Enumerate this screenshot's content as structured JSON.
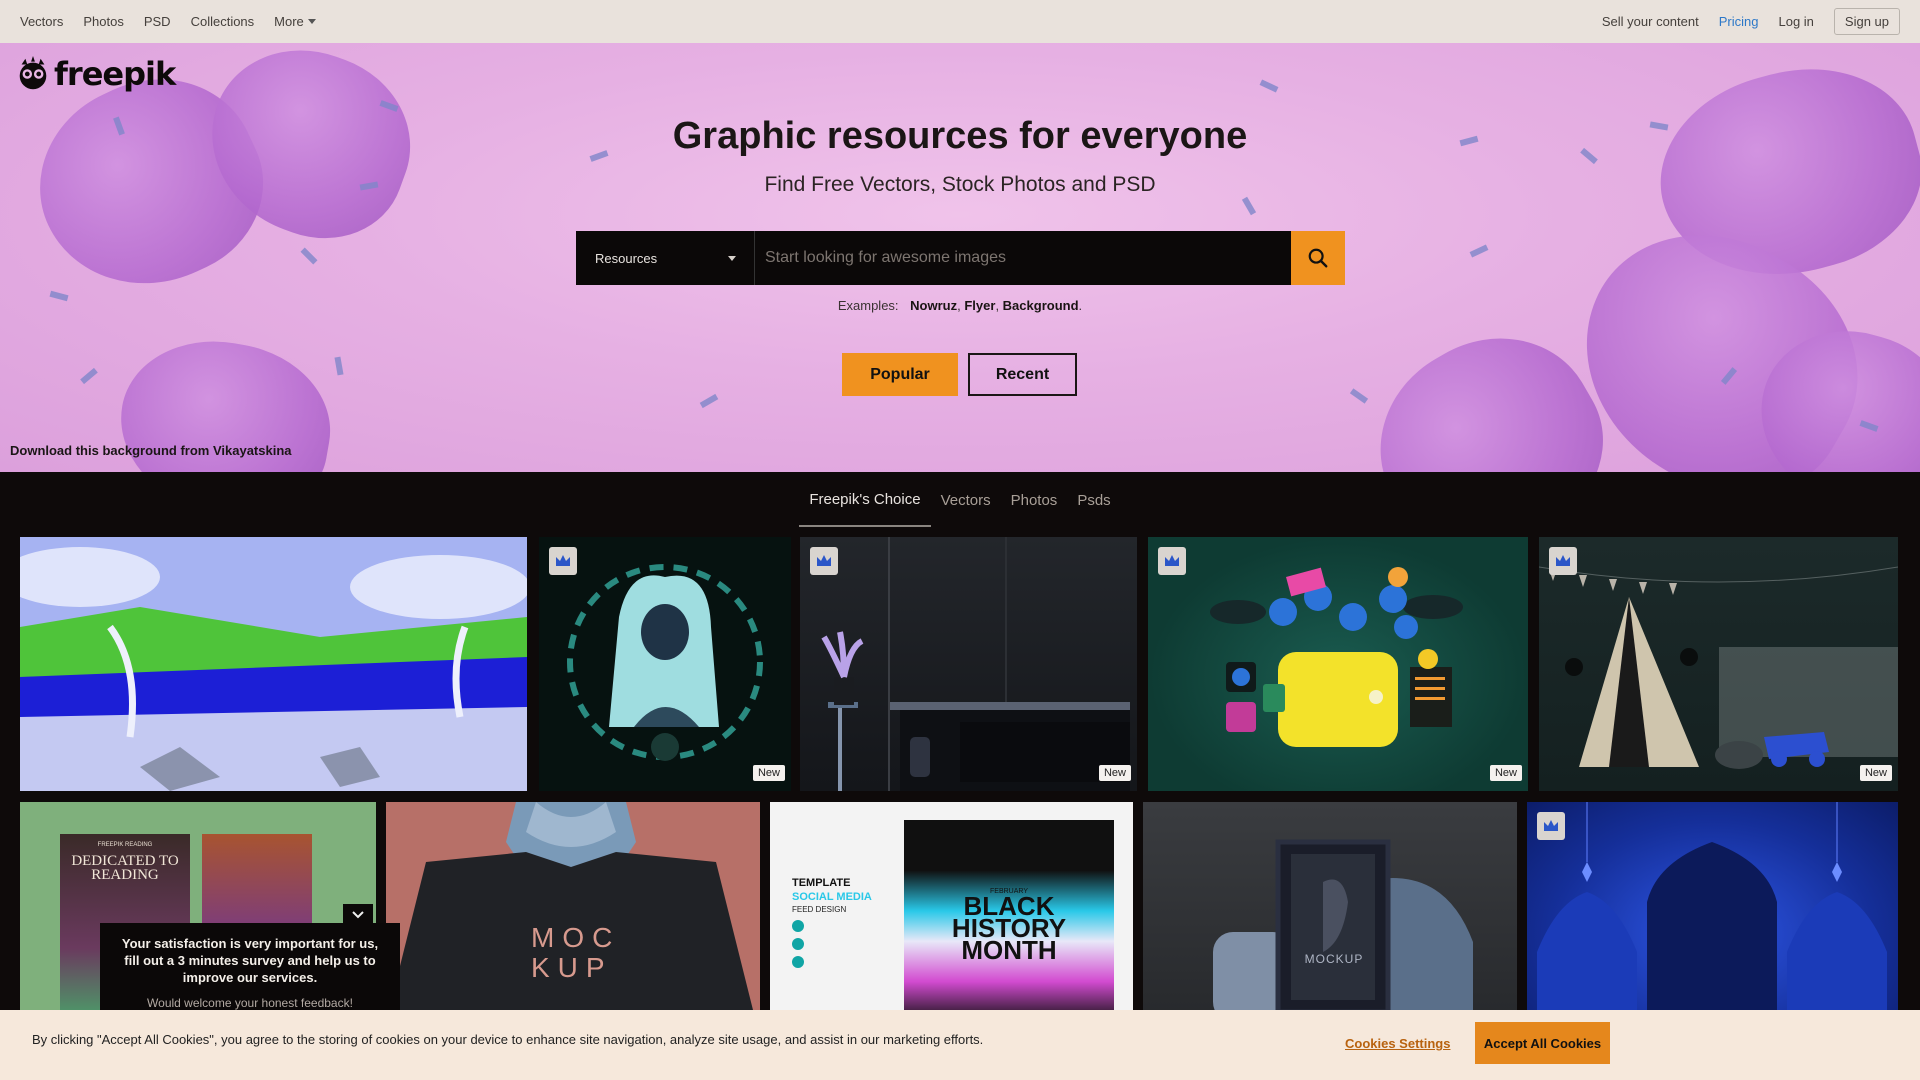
{
  "topnav": {
    "left_links": [
      "Vectors",
      "Photos",
      "PSD",
      "Collections"
    ],
    "more_label": "More",
    "sell_label": "Sell your content",
    "pricing_label": "Pricing",
    "login_label": "Log in",
    "signup_label": "Sign up"
  },
  "brand": {
    "logo_text": "freepik"
  },
  "hero": {
    "title": "Graphic resources for everyone",
    "subtitle": "Find Free Vectors, Stock Photos and PSD",
    "search_type": "Resources",
    "search_placeholder": "Start looking for awesome images",
    "examples_label": "Examples:",
    "examples": [
      "Nowruz",
      "Flyer",
      "Background"
    ],
    "popular_label": "Popular",
    "recent_label": "Recent",
    "credit_text": "Download this background from",
    "credit_author": "Vikayatskina"
  },
  "tabs": [
    "Freepik's Choice",
    "Vectors",
    "Photos",
    "Psds"
  ],
  "cards": [
    {
      "name": "savanna-illustration",
      "crown": false,
      "new": false
    },
    {
      "name": "mother-child-illustration",
      "crown": true,
      "new": true
    },
    {
      "name": "dark-interior-render",
      "crown": true,
      "new": true
    },
    {
      "name": "crypto-wallet-illustration",
      "crown": true,
      "new": true
    },
    {
      "name": "kids-tent-render",
      "crown": true,
      "new": true
    },
    {
      "name": "book-cover-mockup",
      "crown": false,
      "new": false
    },
    {
      "name": "tshirt-mockup",
      "crown": false,
      "new": false
    },
    {
      "name": "social-media-template",
      "crown": false,
      "new": false
    },
    {
      "name": "frame-mockup",
      "crown": false,
      "new": false
    },
    {
      "name": "arabesque-background",
      "crown": true,
      "new": false
    }
  ],
  "card_text": {
    "new_badge": "New",
    "book_small": "FREEPIK READING",
    "book_title": "DEDICATED TO READING",
    "mockup_line1": "MOC",
    "mockup_line2": "KUP",
    "template_title": "TEMPLATE",
    "template_highlight": "SOCIAL MEDIA",
    "template_sub": "FEED DESIGN",
    "bhm_month": "FEBRUARY",
    "bhm_line1": "BLACK",
    "bhm_line2": "HISTORY",
    "bhm_line3": "MONTH",
    "frame_label": "MOCKUP"
  },
  "survey": {
    "heading": "Your satisfaction is very important for us, fill out a 3 minutes survey and help us to improve our services.",
    "sub": "Would welcome your honest feedback!"
  },
  "cookie": {
    "text": "By clicking \"Accept All Cookies\", you agree to the storing of cookies on your device to enhance site navigation, analyze site usage, and assist in our marketing efforts.",
    "settings_label": "Cookies Settings",
    "accept_label": "Accept All Cookies"
  },
  "colors": {
    "accent": "#f0921f",
    "link": "#2d78c8",
    "dark": "#0e0a0a"
  }
}
